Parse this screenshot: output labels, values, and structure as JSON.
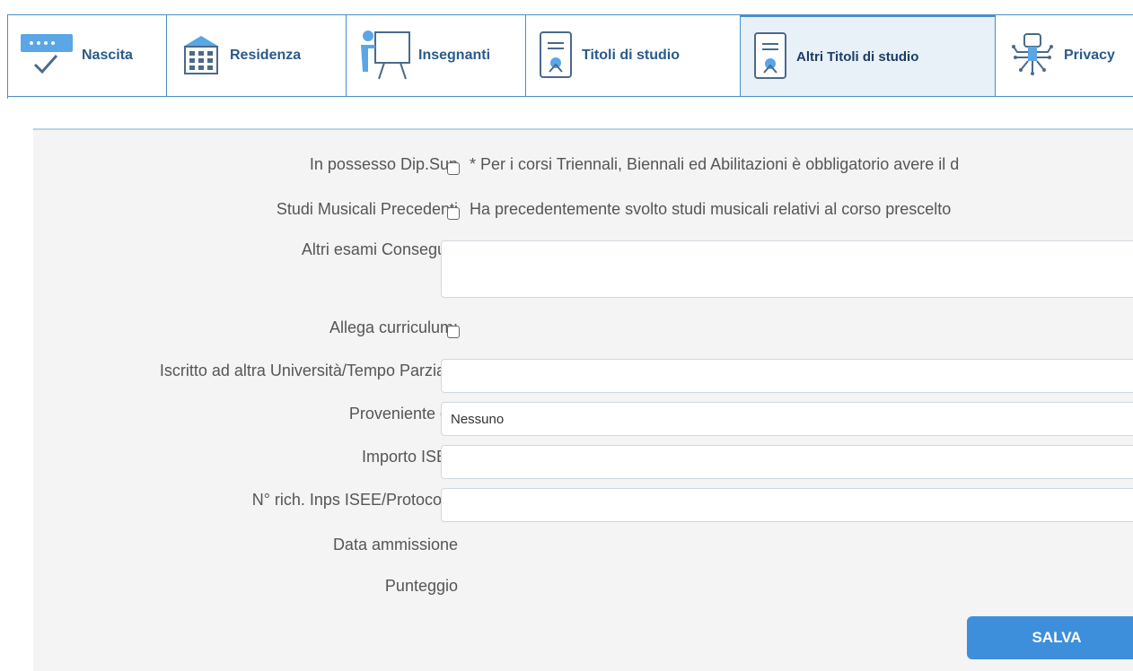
{
  "tabs": [
    {
      "label": "Nascita",
      "icon": "form-check-icon",
      "active": false
    },
    {
      "label": "Residenza",
      "icon": "building-icon",
      "active": false
    },
    {
      "label": "Insegnanti",
      "icon": "teacher-board-icon",
      "active": false
    },
    {
      "label": "Titoli di studio",
      "icon": "certificate-icon",
      "active": false
    },
    {
      "label": "Altri Titoli di studio",
      "icon": "certificate-icon",
      "active": true
    },
    {
      "label": "Privacy",
      "icon": "circuit-lock-icon",
      "active": false
    }
  ],
  "form": {
    "dip_sup": {
      "label": "In possesso Dip.Sup",
      "checked": false,
      "note": "* Per i corsi Triennali, Biennali ed Abilitazioni è obbligatorio avere il d"
    },
    "studi_musicali": {
      "label": "Studi Musicali Precedenti",
      "checked": false,
      "note": "Ha precedentemente svolto studi musicali relativi al corso prescelto"
    },
    "altri_esami": {
      "label": "Altri esami Conseguiti",
      "value": ""
    },
    "curriculum": {
      "label": "Allega curriculum:",
      "checked": false
    },
    "iscritto": {
      "label": "Iscritto ad altra Università/Tempo Parziale",
      "value": ""
    },
    "proveniente": {
      "label": "Proveniente da",
      "value": "Nessuno"
    },
    "isee": {
      "label": "Importo ISEE",
      "value": ""
    },
    "inps": {
      "label": "N° rich. Inps ISEE/Protocollo",
      "value": ""
    },
    "data_ammissione": {
      "label": "Data ammissione"
    },
    "punteggio": {
      "label": "Punteggio"
    },
    "save_label": "SALVA"
  },
  "colors": {
    "accent": "#3d8fdc",
    "tab_border": "#4a8ec8",
    "active_tab_bg": "#e8f0f8"
  }
}
